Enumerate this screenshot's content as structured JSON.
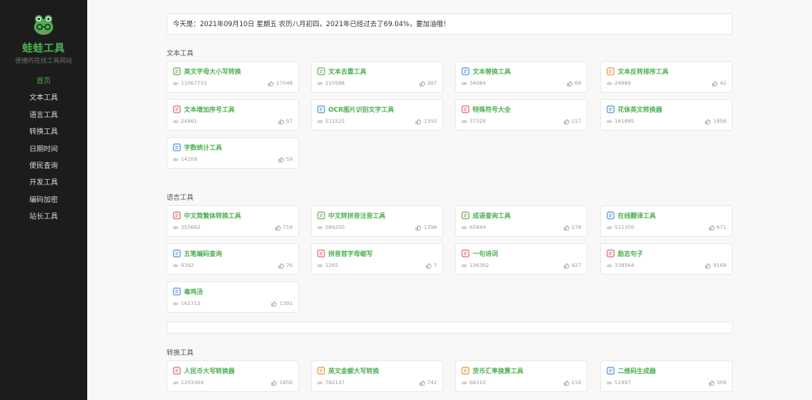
{
  "site": {
    "title": "蛙蛙工具",
    "subtitle": "便捷的在线工具网站"
  },
  "nav": [
    {
      "label": "首页",
      "active": true
    },
    {
      "label": "文本工具"
    },
    {
      "label": "语言工具"
    },
    {
      "label": "转换工具"
    },
    {
      "label": "日期时间"
    },
    {
      "label": "便民查询"
    },
    {
      "label": "开发工具"
    },
    {
      "label": "编码加密"
    },
    {
      "label": "站长工具"
    }
  ],
  "date_banner": "今天是：2021年09月10日 星期五 农历八月初四，2021年已经过去了69.04%，要加油哦！",
  "sections": [
    {
      "title": "文本工具",
      "cards": [
        {
          "title": "英文字母大小写转换",
          "views": "11067755",
          "likes": "17048",
          "icon": "letter-case-icon",
          "color": "#6aa84f"
        },
        {
          "title": "文本去重工具",
          "views": "210588",
          "likes": "387",
          "icon": "document-icon",
          "color": "#6aa84f"
        },
        {
          "title": "文本替换工具",
          "views": "34084",
          "likes": "69",
          "icon": "replace-icon",
          "color": "#4a90d9"
        },
        {
          "title": "文本反转排序工具",
          "views": "24989",
          "likes": "42",
          "icon": "reverse-icon",
          "color": "#e69138"
        },
        {
          "title": "文本增加序号工具",
          "views": "24961",
          "likes": "57",
          "icon": "numbered-list-icon",
          "color": "#e06666"
        },
        {
          "title": "OCR图片识别文字工具",
          "views": "511525",
          "likes": "1350",
          "icon": "ocr-icon",
          "color": "#4a90d9"
        },
        {
          "title": "特殊符号大全",
          "views": "37329",
          "likes": "117",
          "icon": "smiley-icon",
          "color": "#e06666"
        },
        {
          "title": "花体英文转换器",
          "views": "161895",
          "likes": "1858",
          "icon": "fancy-text-icon",
          "color": "#4a90d9"
        },
        {
          "title": "字数统计工具",
          "views": "14109",
          "likes": "59",
          "icon": "chart-line-icon",
          "color": "#4a90d9"
        }
      ]
    },
    {
      "title": "语言工具",
      "cards": [
        {
          "title": "中文简繁体转换工具",
          "views": "355662",
          "likes": "719",
          "icon": "translate-icon",
          "color": "#e06666"
        },
        {
          "title": "中文转拼音注音工具",
          "views": "589250",
          "likes": "1398",
          "icon": "pinyin-icon",
          "color": "#6aa84f"
        },
        {
          "title": "成语查询工具",
          "views": "65844",
          "likes": "278",
          "icon": "idiom-icon",
          "color": "#6aa84f"
        },
        {
          "title": "在线翻译工具",
          "views": "511350",
          "likes": "671",
          "icon": "language-icon",
          "color": "#4a90d9"
        },
        {
          "title": "五笔编码查询",
          "views": "9392",
          "likes": "76",
          "icon": "wubi-icon",
          "color": "#4a90d9"
        },
        {
          "title": "拼音首字母缩写",
          "views": "2265",
          "likes": "7",
          "icon": "abbreviation-icon",
          "color": "#e06666"
        },
        {
          "title": "一句诗词",
          "views": "136302",
          "likes": "927",
          "icon": "poem-icon",
          "color": "#e06666"
        },
        {
          "title": "励志句子",
          "views": "338564",
          "likes": "9168",
          "icon": "heart-icon",
          "color": "#e06666"
        },
        {
          "title": "毒鸡汤",
          "views": "161713",
          "likes": "1391",
          "icon": "bowl-icon",
          "color": "#4a90d9"
        }
      ]
    },
    {
      "title": "转换工具",
      "cards": [
        {
          "title": "人民币大写转换器",
          "views": "1203364",
          "likes": "1856",
          "icon": "rmb-icon",
          "color": "#e06666"
        },
        {
          "title": "英文金额大写转换",
          "views": "782147",
          "likes": "742",
          "icon": "dollar-icon",
          "color": "#e69138"
        },
        {
          "title": "货币汇率换算工具",
          "views": "66310",
          "likes": "219",
          "icon": "exchange-icon",
          "color": "#e69138"
        },
        {
          "title": "二维码生成器",
          "views": "51997",
          "likes": "309",
          "icon": "qrcode-icon",
          "color": "#4a90d9"
        }
      ]
    }
  ],
  "colors": {
    "accent": "#4caf50",
    "sidebar_bg": "#1c1c1c",
    "main_bg": "#f8f8f8"
  }
}
